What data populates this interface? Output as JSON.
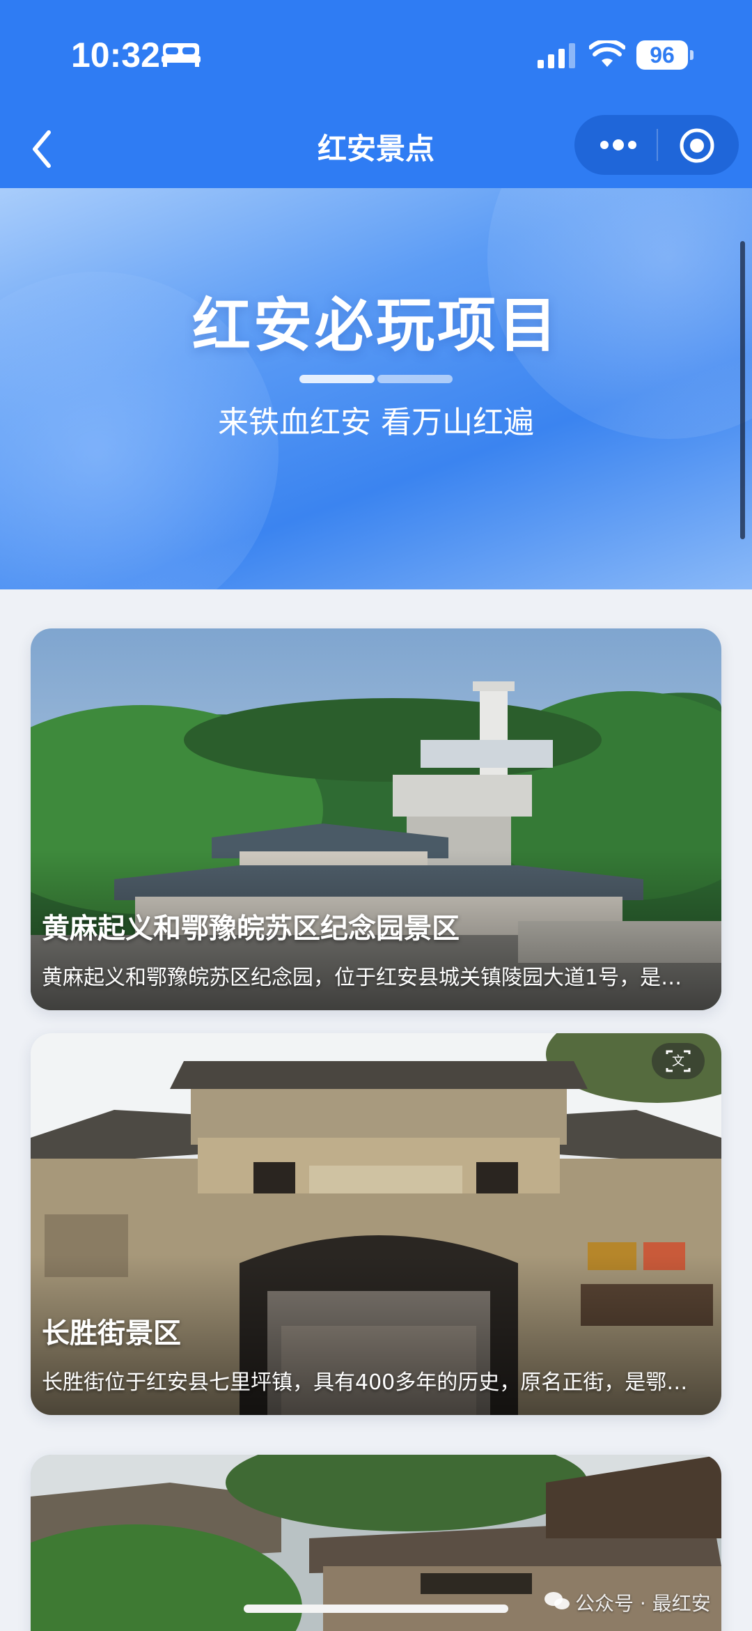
{
  "status_bar": {
    "time": "10:32",
    "battery": "96",
    "icons": [
      "sleep-bed-icon",
      "cellular-signal-icon",
      "wifi-icon",
      "battery-icon"
    ]
  },
  "navbar": {
    "title": "红安景点",
    "back_icon": "chevron-left-icon",
    "menu_icon": "more-dots-icon",
    "close_icon": "target-circle-icon"
  },
  "hero": {
    "title": "红安必玩项目",
    "subtitle": "来铁血红安 看万山红遍"
  },
  "cards": [
    {
      "title": "黄麻起义和鄂豫皖苏区纪念园景区",
      "description": "黄麻起义和鄂豫皖苏区纪念园，位于红安县城关镇陵园大道1号，是全国爱国主义教育示范基地"
    },
    {
      "title": "长胜街景区",
      "description": "长胜街位于红安县七里坪镇，具有400多年的历史，原名正街，是鄂豫皖革命根据地的发源地"
    },
    {
      "title": "",
      "description": ""
    }
  ],
  "watermark": "公众号 · 最红安",
  "colors": {
    "primary": "#2f7cf3",
    "capsule": "#1f66d9",
    "page_background": "#eef1f6"
  }
}
